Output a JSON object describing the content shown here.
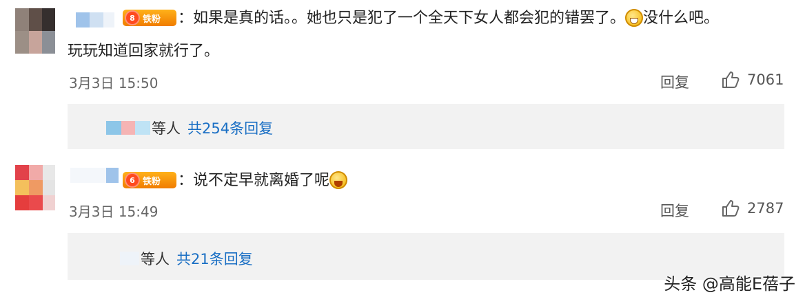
{
  "comments": [
    {
      "fan_badge": "铁粉",
      "fan_level": "8",
      "text_part1": "：如果是真的话。。她也只是犯了一个全天下女人都会犯的错罢了。",
      "text_part2": "没什么吧。",
      "text_line2": "玩玩知道回家就行了。",
      "emoji": "grin-emoji",
      "date": "3月3日",
      "time": "15:50",
      "reply_label": "回复",
      "likes": "7061",
      "sub_suffix": "等人",
      "sub_total": "共254条回复"
    },
    {
      "fan_badge": "铁粉",
      "fan_level": "6",
      "text_part1": "：说不定早就离婚了呢",
      "emoji": "laugh-cry-emoji",
      "date": "3月3日",
      "time": "15:49",
      "reply_label": "回复",
      "likes": "2787",
      "sub_suffix": "等人",
      "sub_total": "共21条回复"
    }
  ],
  "watermark": "头条 @高能E蓓子",
  "colors": {
    "link": "#1a6fc4",
    "badge": "#f07c00",
    "sub_bg": "#f2f2f2"
  }
}
